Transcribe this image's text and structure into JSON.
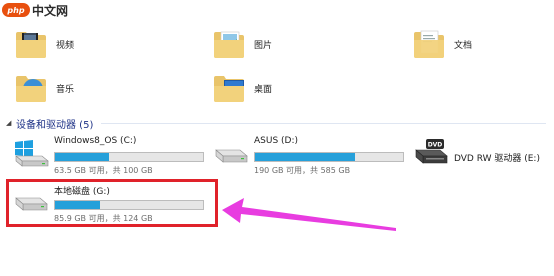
{
  "watermark": {
    "badge": "php",
    "text": "中文网"
  },
  "folders": [
    {
      "label": "视频",
      "icon": "video-folder-icon"
    },
    {
      "label": "图片",
      "icon": "pictures-folder-icon"
    },
    {
      "label": "文档",
      "icon": "documents-folder-icon"
    },
    {
      "label": "音乐",
      "icon": "music-folder-icon"
    },
    {
      "label": "桌面",
      "icon": "desktop-folder-icon"
    }
  ],
  "section": {
    "title": "设备和驱动器 (5)"
  },
  "drives": [
    {
      "name": "Windows8_OS (C:)",
      "info": "63.5 GB 可用，共 100 GB",
      "used_fraction": 0.365,
      "icon": "windows-drive-icon"
    },
    {
      "name": "ASUS (D:)",
      "info": "190 GB 可用，共 585 GB",
      "used_fraction": 0.675,
      "icon": "hard-drive-icon"
    },
    {
      "name": "DVD RW 驱动器 (E:)",
      "icon": "dvd-drive-icon",
      "badge": "DVD"
    },
    {
      "name": "本地磁盘 (G:)",
      "info": "85.9 GB 可用，共 124 GB",
      "used_fraction": 0.307,
      "icon": "hard-drive-icon"
    }
  ],
  "colors": {
    "bar_fill": "#26a0da",
    "highlight": "#e0222a",
    "arrow": "#e83ce0",
    "section_title": "#1e3287"
  }
}
